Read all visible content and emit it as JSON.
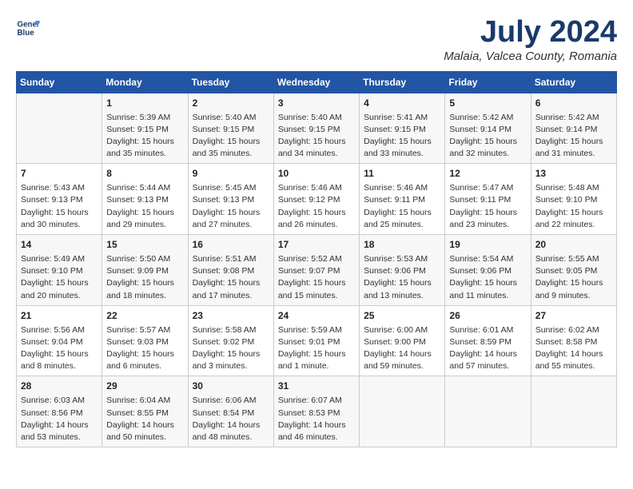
{
  "logo": {
    "line1": "General",
    "line2": "Blue"
  },
  "title": "July 2024",
  "location": "Malaia, Valcea County, Romania",
  "headers": [
    "Sunday",
    "Monday",
    "Tuesday",
    "Wednesday",
    "Thursday",
    "Friday",
    "Saturday"
  ],
  "weeks": [
    [
      {
        "day": "",
        "info": ""
      },
      {
        "day": "1",
        "info": "Sunrise: 5:39 AM\nSunset: 9:15 PM\nDaylight: 15 hours\nand 35 minutes."
      },
      {
        "day": "2",
        "info": "Sunrise: 5:40 AM\nSunset: 9:15 PM\nDaylight: 15 hours\nand 35 minutes."
      },
      {
        "day": "3",
        "info": "Sunrise: 5:40 AM\nSunset: 9:15 PM\nDaylight: 15 hours\nand 34 minutes."
      },
      {
        "day": "4",
        "info": "Sunrise: 5:41 AM\nSunset: 9:15 PM\nDaylight: 15 hours\nand 33 minutes."
      },
      {
        "day": "5",
        "info": "Sunrise: 5:42 AM\nSunset: 9:14 PM\nDaylight: 15 hours\nand 32 minutes."
      },
      {
        "day": "6",
        "info": "Sunrise: 5:42 AM\nSunset: 9:14 PM\nDaylight: 15 hours\nand 31 minutes."
      }
    ],
    [
      {
        "day": "7",
        "info": "Sunrise: 5:43 AM\nSunset: 9:13 PM\nDaylight: 15 hours\nand 30 minutes."
      },
      {
        "day": "8",
        "info": "Sunrise: 5:44 AM\nSunset: 9:13 PM\nDaylight: 15 hours\nand 29 minutes."
      },
      {
        "day": "9",
        "info": "Sunrise: 5:45 AM\nSunset: 9:13 PM\nDaylight: 15 hours\nand 27 minutes."
      },
      {
        "day": "10",
        "info": "Sunrise: 5:46 AM\nSunset: 9:12 PM\nDaylight: 15 hours\nand 26 minutes."
      },
      {
        "day": "11",
        "info": "Sunrise: 5:46 AM\nSunset: 9:11 PM\nDaylight: 15 hours\nand 25 minutes."
      },
      {
        "day": "12",
        "info": "Sunrise: 5:47 AM\nSunset: 9:11 PM\nDaylight: 15 hours\nand 23 minutes."
      },
      {
        "day": "13",
        "info": "Sunrise: 5:48 AM\nSunset: 9:10 PM\nDaylight: 15 hours\nand 22 minutes."
      }
    ],
    [
      {
        "day": "14",
        "info": "Sunrise: 5:49 AM\nSunset: 9:10 PM\nDaylight: 15 hours\nand 20 minutes."
      },
      {
        "day": "15",
        "info": "Sunrise: 5:50 AM\nSunset: 9:09 PM\nDaylight: 15 hours\nand 18 minutes."
      },
      {
        "day": "16",
        "info": "Sunrise: 5:51 AM\nSunset: 9:08 PM\nDaylight: 15 hours\nand 17 minutes."
      },
      {
        "day": "17",
        "info": "Sunrise: 5:52 AM\nSunset: 9:07 PM\nDaylight: 15 hours\nand 15 minutes."
      },
      {
        "day": "18",
        "info": "Sunrise: 5:53 AM\nSunset: 9:06 PM\nDaylight: 15 hours\nand 13 minutes."
      },
      {
        "day": "19",
        "info": "Sunrise: 5:54 AM\nSunset: 9:06 PM\nDaylight: 15 hours\nand 11 minutes."
      },
      {
        "day": "20",
        "info": "Sunrise: 5:55 AM\nSunset: 9:05 PM\nDaylight: 15 hours\nand 9 minutes."
      }
    ],
    [
      {
        "day": "21",
        "info": "Sunrise: 5:56 AM\nSunset: 9:04 PM\nDaylight: 15 hours\nand 8 minutes."
      },
      {
        "day": "22",
        "info": "Sunrise: 5:57 AM\nSunset: 9:03 PM\nDaylight: 15 hours\nand 6 minutes."
      },
      {
        "day": "23",
        "info": "Sunrise: 5:58 AM\nSunset: 9:02 PM\nDaylight: 15 hours\nand 3 minutes."
      },
      {
        "day": "24",
        "info": "Sunrise: 5:59 AM\nSunset: 9:01 PM\nDaylight: 15 hours\nand 1 minute."
      },
      {
        "day": "25",
        "info": "Sunrise: 6:00 AM\nSunset: 9:00 PM\nDaylight: 14 hours\nand 59 minutes."
      },
      {
        "day": "26",
        "info": "Sunrise: 6:01 AM\nSunset: 8:59 PM\nDaylight: 14 hours\nand 57 minutes."
      },
      {
        "day": "27",
        "info": "Sunrise: 6:02 AM\nSunset: 8:58 PM\nDaylight: 14 hours\nand 55 minutes."
      }
    ],
    [
      {
        "day": "28",
        "info": "Sunrise: 6:03 AM\nSunset: 8:56 PM\nDaylight: 14 hours\nand 53 minutes."
      },
      {
        "day": "29",
        "info": "Sunrise: 6:04 AM\nSunset: 8:55 PM\nDaylight: 14 hours\nand 50 minutes."
      },
      {
        "day": "30",
        "info": "Sunrise: 6:06 AM\nSunset: 8:54 PM\nDaylight: 14 hours\nand 48 minutes."
      },
      {
        "day": "31",
        "info": "Sunrise: 6:07 AM\nSunset: 8:53 PM\nDaylight: 14 hours\nand 46 minutes."
      },
      {
        "day": "",
        "info": ""
      },
      {
        "day": "",
        "info": ""
      },
      {
        "day": "",
        "info": ""
      }
    ]
  ]
}
